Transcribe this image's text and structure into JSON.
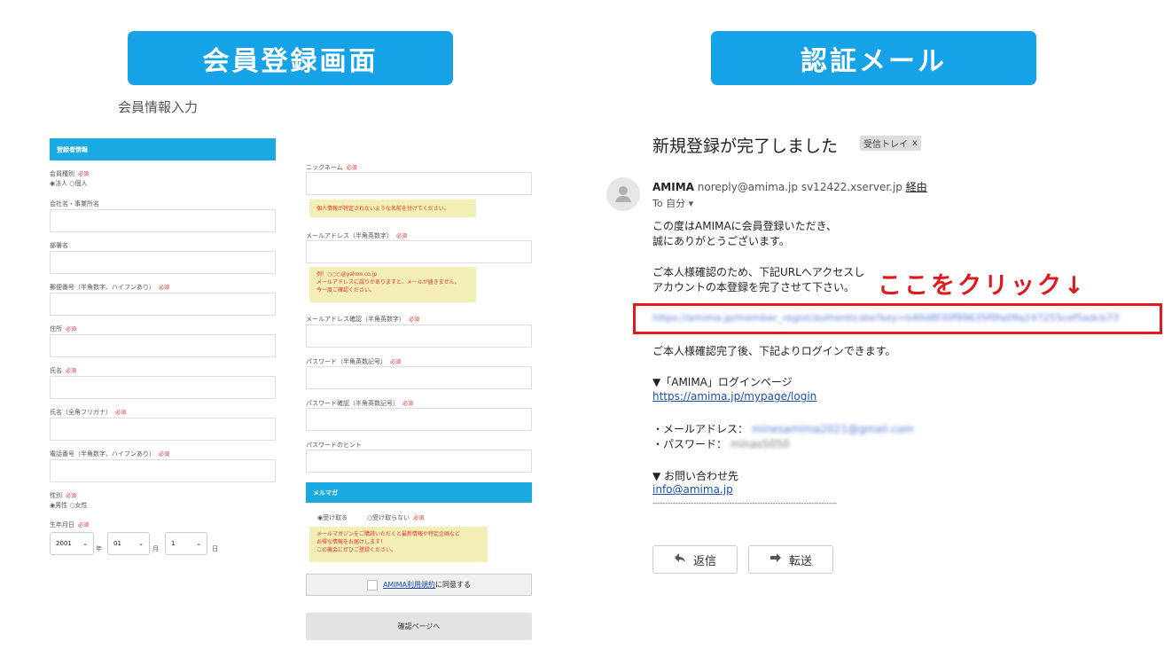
{
  "headers": {
    "left": "会員登録画面",
    "right": "認証メール"
  },
  "form": {
    "page_title": "会員情報入力",
    "section_title": "登録者情報",
    "required_mark": "必須",
    "labels": {
      "member_type": "会員種別",
      "company": "会社名・事業所名",
      "department": "部署名",
      "zip": "郵便番号（半角数字、ハイフンあり）",
      "address": "住所",
      "name": "氏名",
      "kana": "氏名（全角フリガナ）",
      "phone": "電話番号（半角数字、ハイフンあり）",
      "gender": "性別",
      "birthday": "生年月日",
      "nickname": "ニックネーム",
      "email": "メールアドレス（半角英数字）",
      "email_confirm": "メールアドレス確認（半角英数字）",
      "password": "パスワード（半角英数記号）",
      "password_confirm": "パスワード確認（半角英数記号）",
      "password_hint": "パスワードのヒント"
    },
    "member_type_options": "◉法人 ○個人",
    "gender_options": "◉男性 ○女性",
    "birth_year": "2001",
    "birth_month": "01",
    "birth_day": "1",
    "year_unit": "年",
    "month_unit": "月",
    "day_unit": "日",
    "nickname_note": "個人情報が特定されないような名前を付けてください。",
    "email_note_line1": "例）○○○@yahoo.co.jp",
    "email_note_line2": "メールアドレスに誤りがありますと、メールが届きません。",
    "email_note_line3": "今一度ご確認ください。",
    "mailmag_title": "メルマガ",
    "mailmag_receive": "◉受け取る",
    "mailmag_decline": "○受け取らない",
    "mailmag_note_line1": "メールマガジンをご購読いただくと最新情報や特定企画など",
    "mailmag_note_line2": "お得な情報をお届けします！",
    "mailmag_note_line3": "この機会にぜひご登録ください。",
    "terms_link": "AMIMA利用規約",
    "terms_suffix": "に同意する",
    "confirm_button": "確認ページへ"
  },
  "email": {
    "subject": "新規登録が完了しました",
    "label": "受信トレイ",
    "label_close": "x",
    "sender_name": "AMIMA",
    "sender_address": "noreply@amima.jp",
    "via_server": "sv12422.xserver.jp",
    "via": "経由",
    "to": "To 自分",
    "body_line1": "この度はAMIMAに会員登録いただき、",
    "body_line2": "誠にありがとうございます。",
    "body_line3": "ご本人様確認のため、下記URLへアクセスし",
    "body_line4": "アカウントの本登録を完了させて下さい。",
    "verify_link": "https://amima.jp/member_regist/authenticate?key=b40d8f30f99635f0fa09a247255cef5adcb730",
    "after_text": "ご本人様確認完了後、下記よりログインできます。",
    "login_heading": "▼「AMIMA」ログインページ",
    "login_link": "https://amima.jp/mypage/login",
    "email_label": "・メールアドレス：",
    "email_value": "minesamima2021@gmail.com",
    "password_label": "・パスワード：",
    "password_value": "minas5050",
    "contact_heading": "▼ お問い合わせ先",
    "contact_link": "info@amima.jp",
    "divider": "------------------------------------------------------------------------",
    "reply_button": "返信",
    "forward_button": "転送"
  },
  "annotation": {
    "click_here": "ここをクリック↓",
    "color": "#e0191f"
  },
  "colors": {
    "accent": "#16a2e6",
    "note_bg": "#f2eeb5"
  }
}
